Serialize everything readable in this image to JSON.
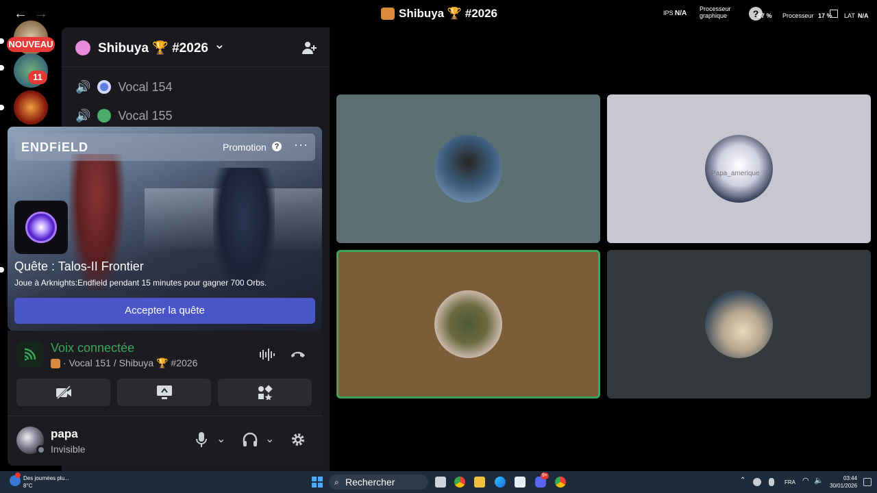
{
  "window": {
    "title": "Shibuya 🏆 #2026",
    "back": "←",
    "forward": "→"
  },
  "overlay": {
    "ips_label": "IPS",
    "ips_value": "N/A",
    "gpu_label": "Processeur graphique",
    "gpu_value": "27 %",
    "cpu_label": "Processeur",
    "cpu_value": "17 %",
    "lat_label": "LAT",
    "lat_value": "N/A"
  },
  "servers": {
    "new_badge": "NOUVEAU",
    "mention_count": "11"
  },
  "server_header": {
    "name": "Shibuya 🏆 #2026",
    "chevron": "⌄"
  },
  "channels": [
    {
      "name": "Vocal 154"
    },
    {
      "name": "Vocal 155"
    }
  ],
  "promo": {
    "logo": "ENDFiELD",
    "tag": "Promotion",
    "help": "?",
    "more": "···",
    "quest_title": "Quête : Talos-II Frontier",
    "quest_desc": "Joue à Arknights:Endfield pendant 15 minutes pour gagner 700 Orbs.",
    "accept_label": "Accepter la quête"
  },
  "voice": {
    "status": "Voix connectée",
    "location": "Vocal 151 / Shibuya 🏆 #2026"
  },
  "user": {
    "name": "papa",
    "status": "Invisible"
  },
  "tiles": [
    {
      "bg": "#5b6f70",
      "face": "#3a5a7a"
    },
    {
      "bg": "#c8c6cf",
      "face": "#e9e6ea",
      "label": "Papa_amerique"
    },
    {
      "bg": "#7d5c3a",
      "face": "#a0876e",
      "border": "#3ba55c"
    },
    {
      "bg": "#343a3c",
      "face": "#6d7078"
    }
  ],
  "taskbar": {
    "weather_title": "Des journées plu...",
    "weather_temp": "8°C",
    "search": "Rechercher",
    "lang": "FRA",
    "time": "03:44",
    "date": "30/01/2026",
    "discord_badge": "9+"
  },
  "colors": {
    "accent": "#4a56c8",
    "green": "#3ba55c",
    "badge_red": "#e53935"
  }
}
